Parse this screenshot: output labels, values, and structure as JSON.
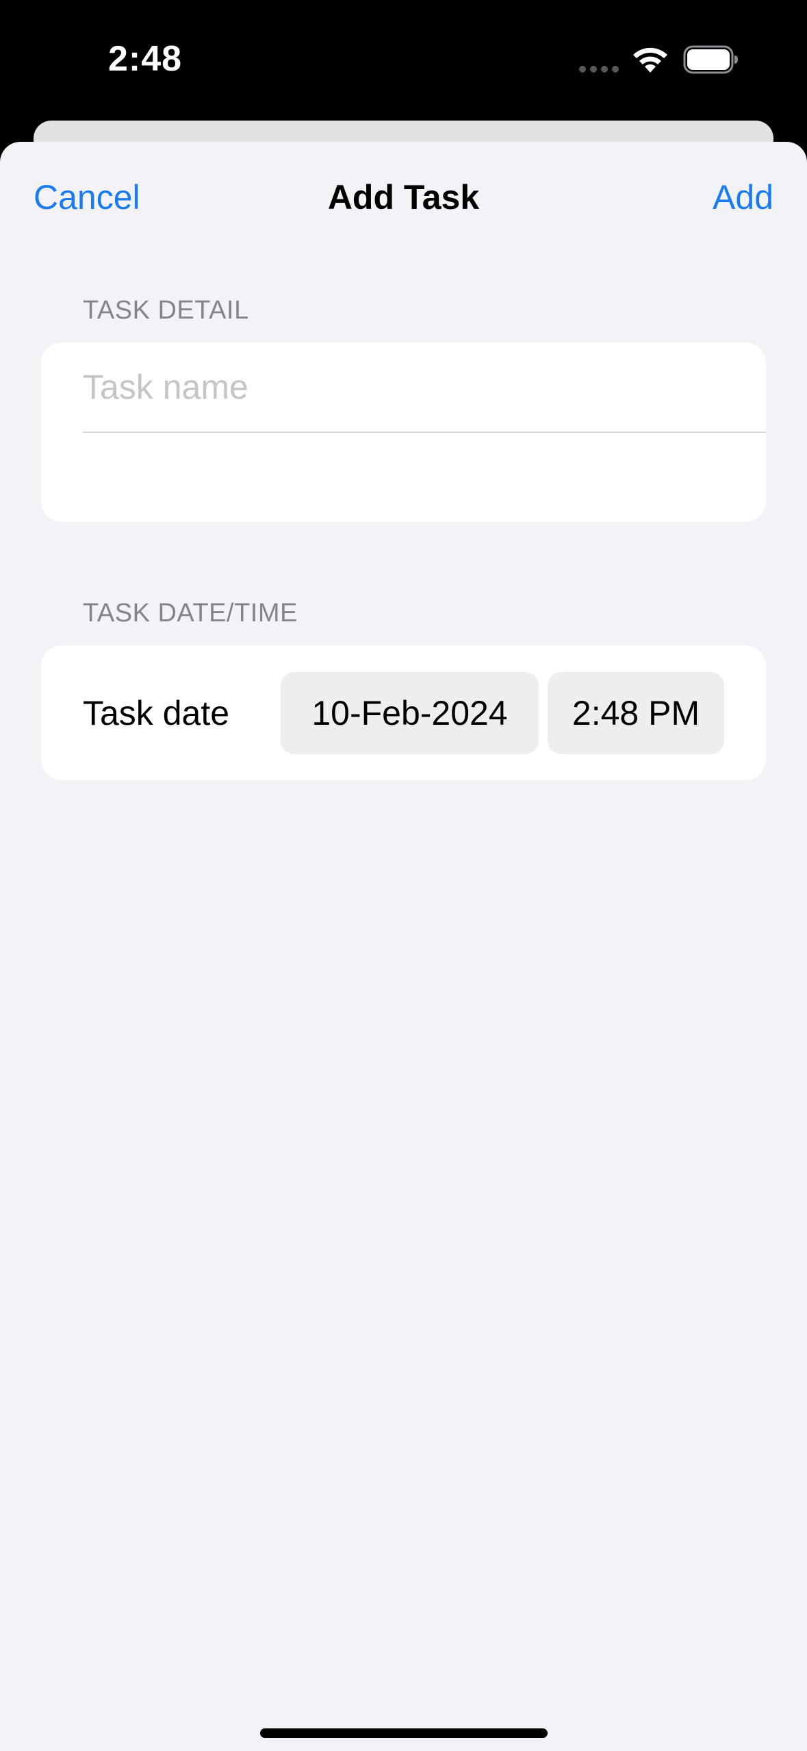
{
  "status_bar": {
    "time": "2:48",
    "icons": [
      "cellular-signal-icon",
      "wifi-icon",
      "battery-icon"
    ]
  },
  "nav": {
    "cancel_label": "Cancel",
    "title": "Add Task",
    "add_label": "Add"
  },
  "task_detail": {
    "header": "TASK DETAIL",
    "name_value": "",
    "name_placeholder": "Task name"
  },
  "task_datetime": {
    "header": "TASK DATE/TIME",
    "label": "Task date",
    "date_value": "10-Feb-2024",
    "time_value": "2:48 PM"
  },
  "colors": {
    "accent": "#1a7cf0",
    "background": "#f2f2f7",
    "card": "#ffffff",
    "secondary_text": "#858589",
    "placeholder": "#c5c5c7",
    "pill": "#eeeeef"
  }
}
